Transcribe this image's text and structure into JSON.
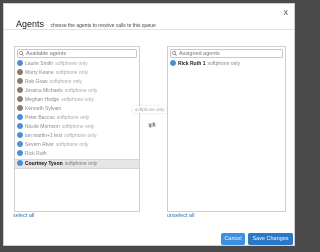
{
  "dialog": {
    "title": "Agents",
    "subtitle": "choose the agents to receive calls to this queue",
    "close_glyph": "x"
  },
  "available": {
    "placeholder": "Available agents",
    "items": [
      {
        "name": "Laurie Smith",
        "sub": "softphone only",
        "avatar": "blue"
      },
      {
        "name": "Marry Keane",
        "sub": "softphone only",
        "avatar": "photo"
      },
      {
        "name": "Rob Graw",
        "sub": "softphone only",
        "avatar": "photo"
      },
      {
        "name": "Jessica Michaels",
        "sub": "softphone only",
        "avatar": "photo"
      },
      {
        "name": "Meghan Hodge",
        "sub": "softphone only",
        "avatar": "photo"
      },
      {
        "name": "Kenneth Sylvain",
        "sub": "",
        "avatar": "photo"
      },
      {
        "name": "Peter Baccus",
        "sub": "softphone only",
        "avatar": "blue"
      },
      {
        "name": "Nicole Morrison",
        "sub": "softphone only",
        "avatar": "blue"
      },
      {
        "name": "ian martin+1 test",
        "sub": "softphone only",
        "avatar": "blue"
      },
      {
        "name": "Severn River",
        "sub": "softphone only",
        "avatar": "blue"
      },
      {
        "name": "Rick Ruth",
        "sub": "",
        "avatar": "blue"
      },
      {
        "name": "Courtney Tyson",
        "sub": "softphone only",
        "avatar": "blue",
        "selected": true
      }
    ],
    "select_all": "select all"
  },
  "dragging_ghost": "softphone only",
  "assigned": {
    "placeholder": "Assigned agents",
    "items": [
      {
        "name": "Rick Ruth 1",
        "sub": "softphone only",
        "avatar": "blue"
      }
    ],
    "unselect_all": "unselect all"
  },
  "buttons": {
    "cancel": "Cancel",
    "save": "Save Changes"
  },
  "colors": {
    "accent": "#2a78c8",
    "avatar_blue": "#4a90d9",
    "avatar_photo": "#8a7a70",
    "link": "#2a6eb8"
  },
  "icons": {
    "search": "magnifier-icon",
    "transfer": "swap-arrows-icon",
    "close": "close-icon"
  }
}
